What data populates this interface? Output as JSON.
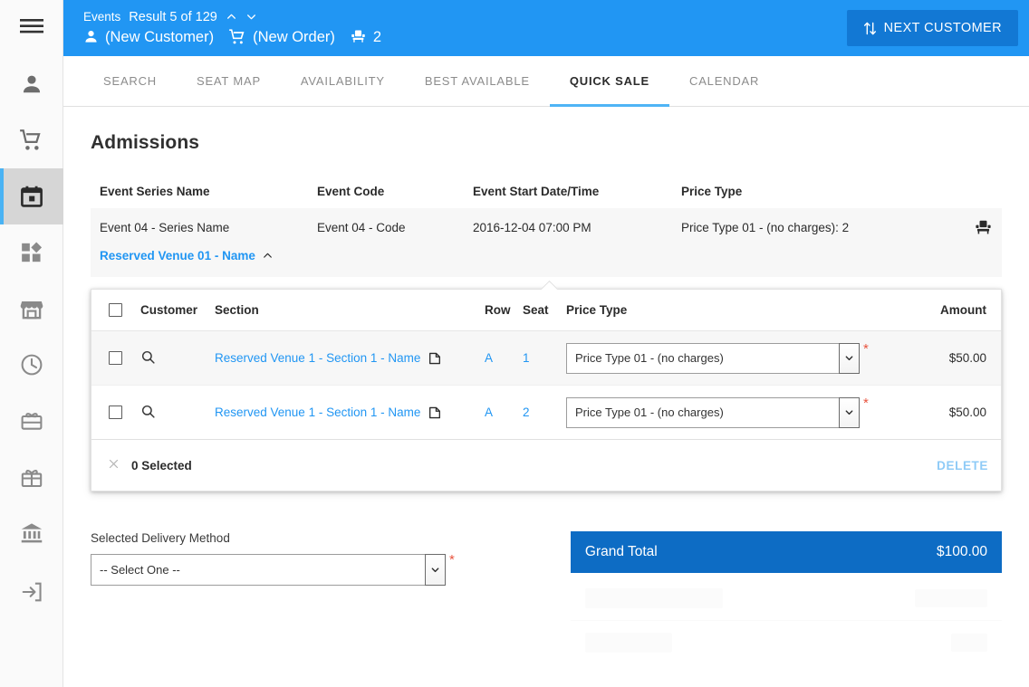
{
  "sidebar": {
    "items": [
      {
        "icon": "hamburger-menu-icon",
        "name": "menu-toggle"
      },
      {
        "icon": "person-icon",
        "name": "sidebar-item-customers"
      },
      {
        "icon": "shopping-cart-icon",
        "name": "sidebar-item-orders"
      },
      {
        "icon": "calendar-icon",
        "name": "sidebar-item-events",
        "active": true
      },
      {
        "icon": "dashboard-apps-icon",
        "name": "sidebar-item-dashboard"
      },
      {
        "icon": "storefront-icon",
        "name": "sidebar-item-store"
      },
      {
        "icon": "clock-icon",
        "name": "sidebar-item-history"
      },
      {
        "icon": "gift-card-icon",
        "name": "sidebar-item-gift-cards"
      },
      {
        "icon": "gift-box-icon",
        "name": "sidebar-item-gifts"
      },
      {
        "icon": "bank-icon",
        "name": "sidebar-item-finance"
      },
      {
        "icon": "exit-logout-icon",
        "name": "sidebar-item-logout"
      }
    ]
  },
  "topbar": {
    "section_label": "Events",
    "result_label": "Result 5 of 129",
    "customer_label": "(New Customer)",
    "order_label": "(New Order)",
    "seat_count": "2",
    "next_customer_button": "NEXT CUSTOMER",
    "accent_color": "#2196f3",
    "button_color": "#1278d4"
  },
  "tabs": [
    {
      "label": "SEARCH",
      "active": false
    },
    {
      "label": "SEAT MAP",
      "active": false
    },
    {
      "label": "AVAILABILITY",
      "active": false
    },
    {
      "label": "BEST AVAILABLE",
      "active": false
    },
    {
      "label": "QUICK SALE",
      "active": true
    },
    {
      "label": "CALENDAR",
      "active": false
    }
  ],
  "page": {
    "title": "Admissions"
  },
  "event_summary": {
    "headers": {
      "series": "Event Series Name",
      "code": "Event Code",
      "date": "Event Start Date/Time",
      "price_type": "Price Type"
    },
    "row": {
      "series": "Event 04 - Series Name",
      "code": "Event 04 - Code",
      "date": "2016-12-04 07:00 PM",
      "price_type": "Price Type 01 - (no charges): 2"
    },
    "venue_link": "Reserved Venue 01 - Name"
  },
  "admissions_grid": {
    "headers": {
      "customer": "Customer",
      "section": "Section",
      "row": "Row",
      "seat": "Seat",
      "price_type": "Price Type",
      "amount": "Amount"
    },
    "rows": [
      {
        "section": "Reserved Venue 1 - Section 1 - Name",
        "row": "A",
        "seat": "1",
        "price_type": "Price Type 01 - (no charges)",
        "amount": "$50.00"
      },
      {
        "section": "Reserved Venue 1 - Section 1 - Name",
        "row": "A",
        "seat": "2",
        "price_type": "Price Type 01 - (no charges)",
        "amount": "$50.00"
      }
    ],
    "footer": {
      "selected_count": "0 Selected",
      "delete_label": "DELETE"
    }
  },
  "delivery": {
    "label": "Selected Delivery Method",
    "selected_value": "-- Select One --"
  },
  "totals": {
    "grand_total_label": "Grand Total",
    "grand_total_value": "$100.00",
    "bar_color": "#0d6cc4"
  }
}
